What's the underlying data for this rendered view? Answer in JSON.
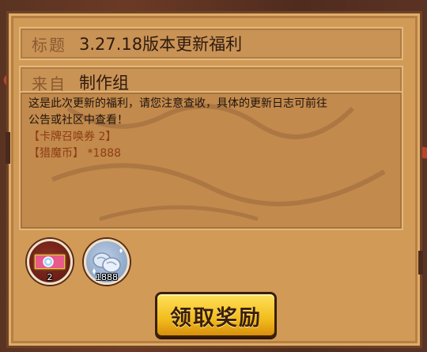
{
  "mail": {
    "title_label": "标题",
    "title_value": "3.27.18版本更新福利",
    "from_label": "来自",
    "from_value": "制作组",
    "message_line1": "这是此次更新的福利，请您注意查收，具体的更新日志可前往",
    "message_line2": "公告或社区中查看！",
    "reward_lines": [
      "【卡牌召唤券 2】",
      "【猎魔币】 *1888"
    ]
  },
  "attachments": [
    {
      "icon": "card-summon-ticket-icon",
      "count": "2"
    },
    {
      "icon": "demon-hunter-coin-icon",
      "count": "1888"
    }
  ],
  "claim_button_label": "领取奖励",
  "colors": {
    "parchment": "#d19a57",
    "reward_text": "#8f3d12",
    "button": "#f2bd1e"
  }
}
